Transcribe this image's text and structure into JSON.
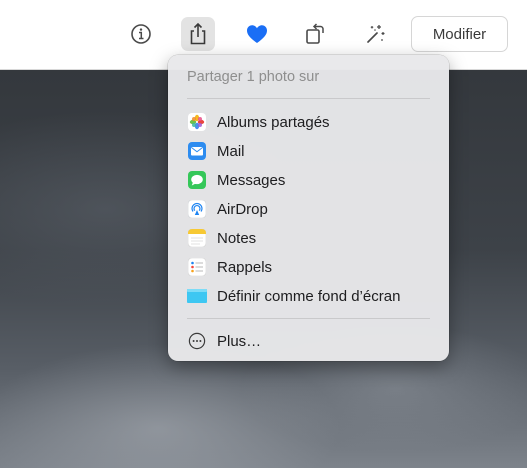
{
  "toolbar": {
    "info_icon": "info-circle-icon",
    "share_icon": "share-icon",
    "favorite_icon": "heart-icon",
    "rotate_icon": "rotate-icon",
    "enhance_icon": "magic-wand-icon",
    "modify_label": "Modifier"
  },
  "colors": {
    "heart": "#1a6ef5",
    "toolbar_bg": "#ffffff",
    "menu_bg": "#e8e8ea"
  },
  "share_menu": {
    "header": "Partager 1 photo sur",
    "items": [
      {
        "label": "Albums partagés",
        "icon": "photos-app-icon"
      },
      {
        "label": "Mail",
        "icon": "mail-app-icon"
      },
      {
        "label": "Messages",
        "icon": "messages-app-icon"
      },
      {
        "label": "AirDrop",
        "icon": "airdrop-icon"
      },
      {
        "label": "Notes",
        "icon": "notes-app-icon"
      },
      {
        "label": "Rappels",
        "icon": "reminders-app-icon"
      },
      {
        "label": "Définir comme fond d’écran",
        "icon": "wallpaper-icon"
      }
    ],
    "more_label": "Plus…",
    "more_icon": "more-ellipsis-icon"
  }
}
